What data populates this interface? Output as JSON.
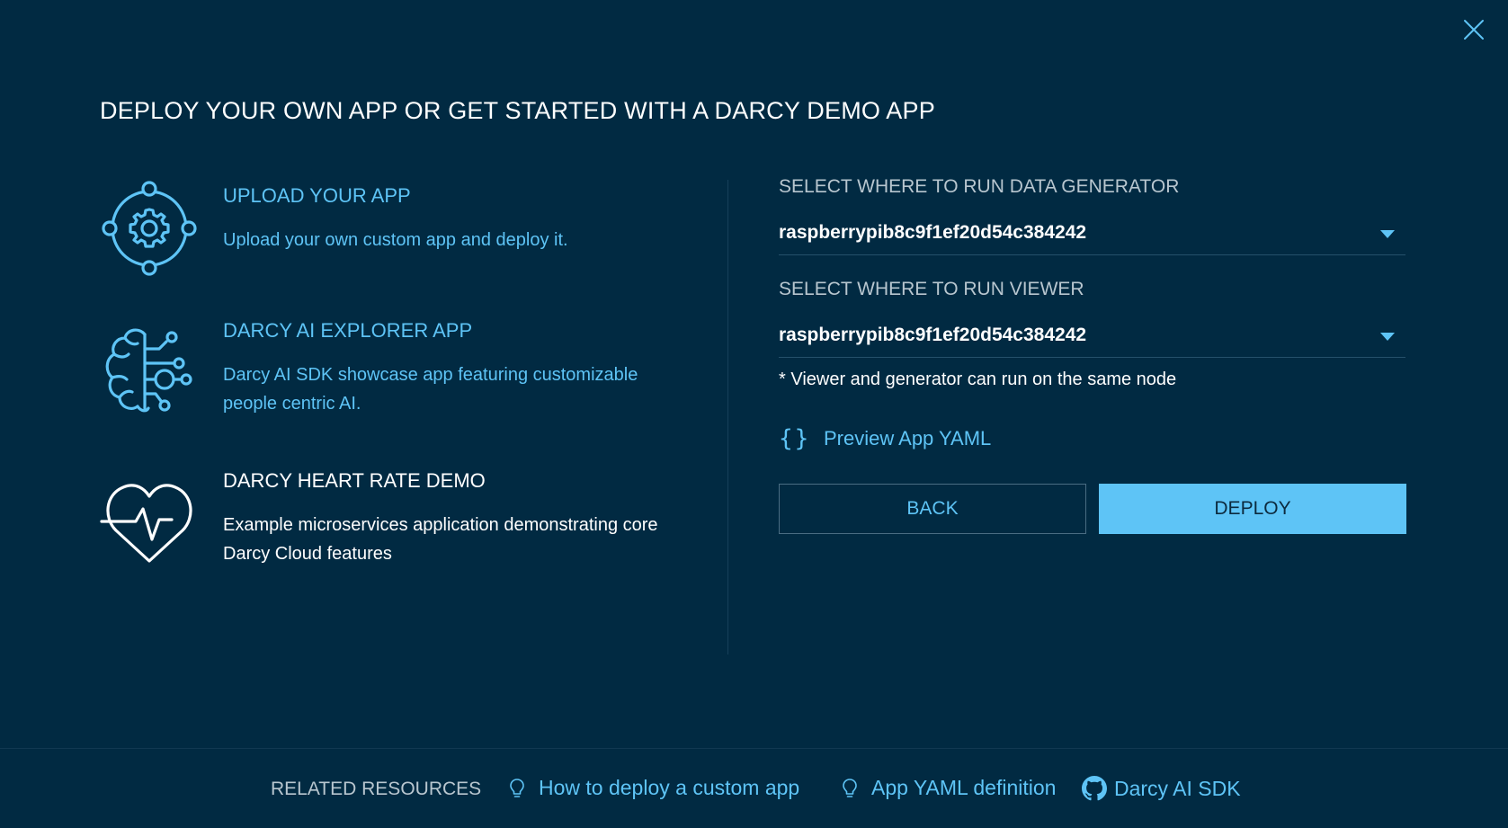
{
  "title": "DEPLOY YOUR OWN APP OR GET STARTED WITH A DARCY DEMO APP",
  "apps": [
    {
      "title": "UPLOAD YOUR APP",
      "description": "Upload your own custom app and deploy it.",
      "icon": "gear-target-icon"
    },
    {
      "title": "DARCY AI EXPLORER APP",
      "description": "Darcy AI SDK showcase app featuring customizable people centric AI.",
      "icon": "brain-circuit-icon"
    },
    {
      "title": "DARCY HEART RATE DEMO",
      "description": "Example microservices application demonstrating core Darcy Cloud features",
      "icon": "heart-rate-icon"
    }
  ],
  "generator": {
    "label": "SELECT WHERE TO RUN DATA GENERATOR",
    "value": "raspberrypib8c9f1ef20d54c384242"
  },
  "viewer": {
    "label": "SELECT WHERE TO RUN VIEWER",
    "value": "raspberrypib8c9f1ef20d54c384242"
  },
  "note": "* Viewer and generator can run on the same node",
  "preview": {
    "icon": "{}",
    "label": "Preview App YAML"
  },
  "buttons": {
    "back": "BACK",
    "deploy": "DEPLOY"
  },
  "footer": {
    "label": "RELATED RESOURCES",
    "links": [
      {
        "label": "How to deploy a custom app",
        "icon": "lightbulb-icon"
      },
      {
        "label": "App YAML definition",
        "icon": "lightbulb-icon"
      },
      {
        "label": "Darcy AI SDK",
        "icon": "github-icon"
      }
    ]
  },
  "colors": {
    "background": "#012a42",
    "accent": "#5ec4f6",
    "muted_text": "#b8c6cf",
    "text": "#ffffff"
  }
}
